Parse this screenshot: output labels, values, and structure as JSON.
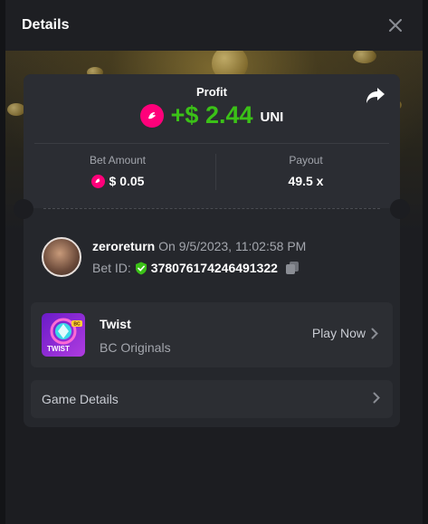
{
  "header": {
    "title": "Details"
  },
  "summary": {
    "profit_label": "Profit",
    "profit_value": "+$ 2.44",
    "profit_unit": "UNI",
    "bet_amount_label": "Bet Amount",
    "bet_amount_value": "$ 0.05",
    "payout_label": "Payout",
    "payout_value": "49.5 x"
  },
  "bet": {
    "username": "zeroreturn",
    "datetime": "On 9/5/2023, 11:02:58 PM",
    "bet_id_label": "Bet ID:",
    "bet_id": "378076174246491322"
  },
  "game": {
    "name": "Twist",
    "provider": "BC Originals",
    "play_label": "Play Now",
    "thumb_label": "TWIST",
    "thumb_tag": "BC"
  },
  "game_details": {
    "label": "Game Details"
  },
  "colors": {
    "profit_green": "#3bc117",
    "uni_pink": "#ff007a",
    "verified_green": "#3bc117",
    "background": "#1c1d21"
  },
  "icons": {
    "close": "close-icon",
    "share": "share-icon",
    "token": "uni-token-icon",
    "verified": "shield-check-icon",
    "copy": "copy-icon",
    "chevron": "chevron-right-icon"
  }
}
